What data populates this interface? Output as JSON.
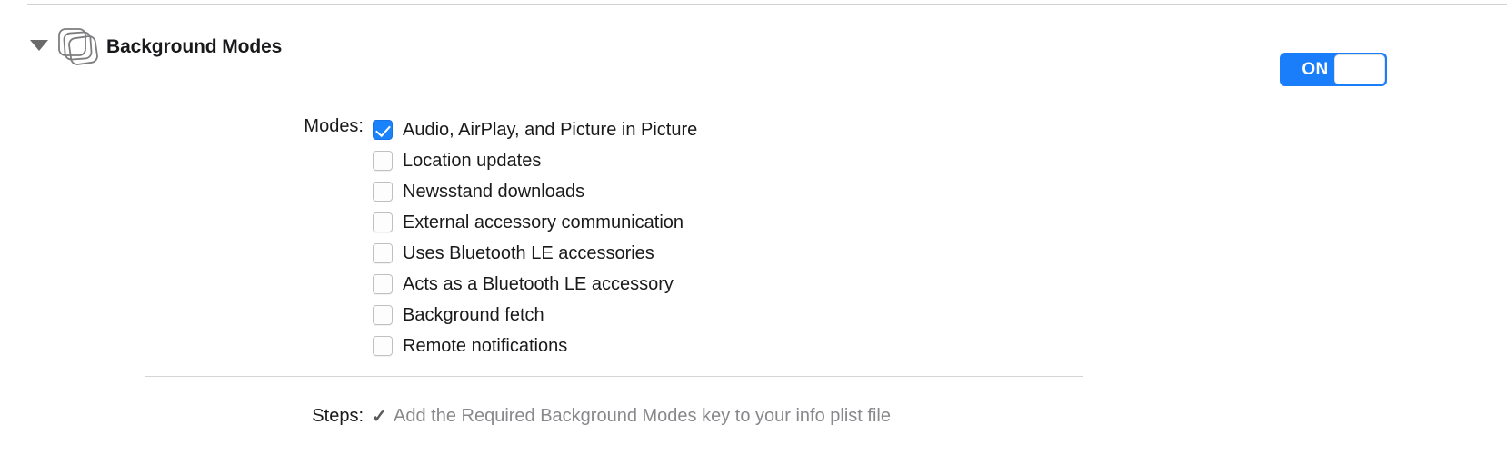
{
  "header": {
    "title": "Background Modes",
    "disclosure_icon": "disclosure-triangle-down-icon",
    "capability_icon": "stacked-squares-icon",
    "toggle": {
      "label": "ON",
      "state": "on",
      "accent_color": "#1a7efb"
    }
  },
  "modes": {
    "label": "Modes:",
    "items": [
      {
        "label": "Audio, AirPlay, and Picture in Picture",
        "checked": true
      },
      {
        "label": "Location updates",
        "checked": false
      },
      {
        "label": "Newsstand downloads",
        "checked": false
      },
      {
        "label": "External accessory communication",
        "checked": false
      },
      {
        "label": "Uses Bluetooth LE accessories",
        "checked": false
      },
      {
        "label": "Acts as a Bluetooth LE accessory",
        "checked": false
      },
      {
        "label": "Background fetch",
        "checked": false
      },
      {
        "label": "Remote notifications",
        "checked": false
      }
    ]
  },
  "steps": {
    "label": "Steps:",
    "check_glyph": "✓",
    "text": "Add the Required Background Modes key to your info plist file"
  },
  "colors": {
    "checkbox_checked": "#1a82fb",
    "rule": "#d2d2d2",
    "text": "#1a1a1c",
    "muted_text": "#88888c"
  }
}
